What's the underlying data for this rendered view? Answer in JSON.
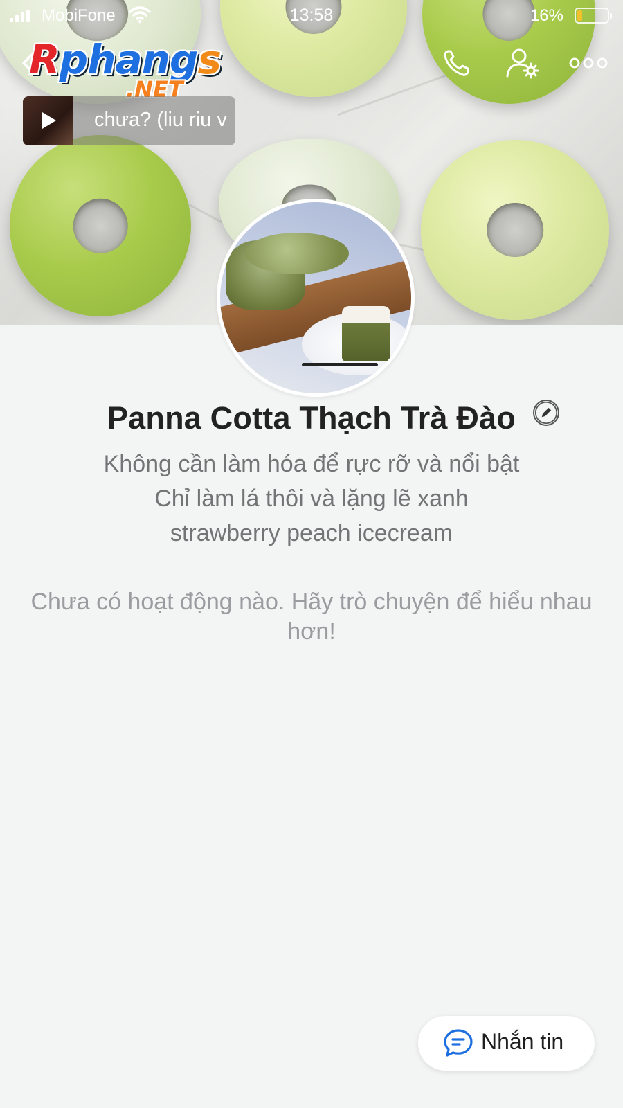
{
  "status_bar": {
    "carrier": "MobiFone",
    "time": "13:58",
    "battery_percent": "16%",
    "battery_level": 0.16
  },
  "watermark": {
    "main": "Rphangs",
    "sub": ".NET"
  },
  "header": {
    "icons": [
      "back-icon",
      "phone-icon",
      "user-settings-icon",
      "more-icon"
    ]
  },
  "music": {
    "title": "chưa? (liu riu v"
  },
  "profile": {
    "name": "Panna Cotta Thạch Trà Đào",
    "bio": [
      "Không cần làm hóa để rực rỡ và nổi bật",
      "Chỉ làm lá thôi và lặng lẽ xanh",
      "strawberry peach icecream"
    ]
  },
  "activity": {
    "empty_message": "Chưa có hoạt động nào. Hãy trò chuyện để hiểu nhau hơn!"
  },
  "actions": {
    "message_label": "Nhắn tin"
  },
  "colors": {
    "background": "#f3f4f4",
    "accent": "#1d6fe0",
    "name_text": "#222222",
    "bio_text": "#727476"
  }
}
